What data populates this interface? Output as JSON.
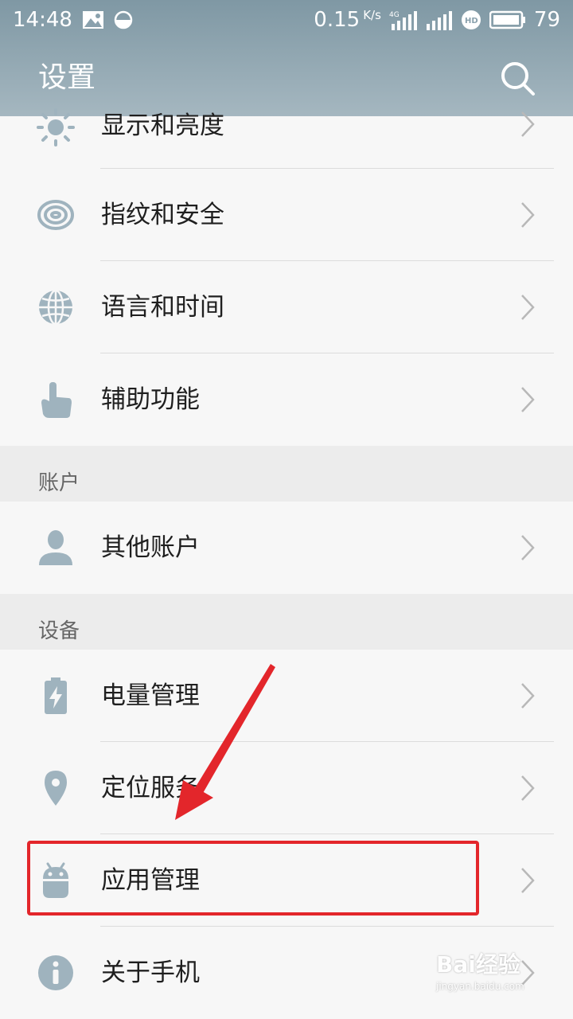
{
  "status_bar": {
    "time": "14:48",
    "speed": "0.15",
    "speed_unit": "K/s",
    "network": "4G",
    "battery": "79"
  },
  "header": {
    "title": "设置"
  },
  "rows": [
    {
      "label": "显示和亮度",
      "icon": "brightness-icon"
    },
    {
      "label": "指纹和安全",
      "icon": "fingerprint-icon"
    },
    {
      "label": "语言和时间",
      "icon": "globe-icon"
    },
    {
      "label": "辅助功能",
      "icon": "hand-pointer-icon"
    }
  ],
  "sections": {
    "account": {
      "title": "账户",
      "rows": [
        {
          "label": "其他账户",
          "icon": "person-icon"
        }
      ]
    },
    "device": {
      "title": "设备",
      "rows": [
        {
          "label": "电量管理",
          "icon": "battery-icon"
        },
        {
          "label": "定位服务",
          "icon": "location-pin-icon"
        },
        {
          "label": "应用管理",
          "icon": "android-icon"
        },
        {
          "label": "关于手机",
          "icon": "info-icon"
        }
      ]
    }
  },
  "colors": {
    "header_top": "#7f98a4",
    "header_bottom": "#a5b7c0",
    "icon": "#9fb3be",
    "annotation": "#e3262b"
  },
  "watermark": {
    "brand": "Bai经验",
    "url": "jingyan.baidu.com"
  }
}
